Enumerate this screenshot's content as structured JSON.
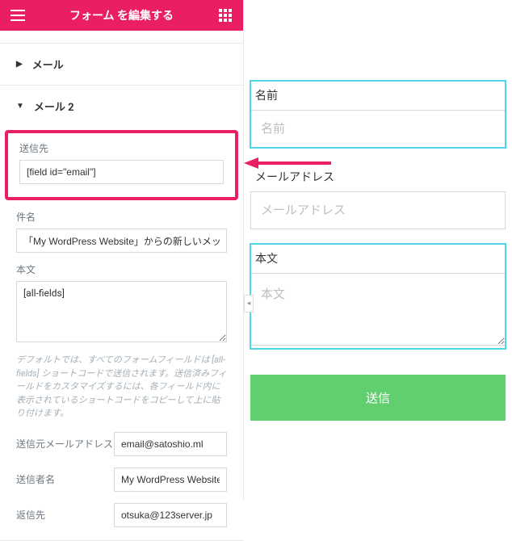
{
  "topbar": {
    "title": "フォーム を編集する"
  },
  "sections": {
    "mail": {
      "label": "メール"
    },
    "mail2": {
      "label": "メール 2",
      "to_label": "送信先",
      "to_value": "[field id=\"email\"]",
      "subject_label": "件名",
      "subject_value": "「My WordPress Website」からの新しいメッセージ",
      "body_label": "本文",
      "body_value": "[all-fields]",
      "help_text": "デフォルトでは、すべてのフォームフィールドは [all-fields] ショートコードで送信されます。送信済みフィールドをカスタマイズするには、各フィールド内に表示されているショートコードをコピーして上に貼り付けます。",
      "from_email_label": "送信元メールアドレス",
      "from_email_value": "email@satoshio.ml",
      "from_name_label": "送信者名",
      "from_name_value": "My WordPress Website",
      "reply_to_label": "返信先",
      "reply_to_value": "otsuka@123server.jp"
    }
  },
  "preview": {
    "name_label": "名前",
    "name_placeholder": "名前",
    "email_label": "メールアドレス",
    "email_placeholder": "メールアドレス",
    "body_label": "本文",
    "body_placeholder": "本文",
    "submit_label": "送信"
  }
}
